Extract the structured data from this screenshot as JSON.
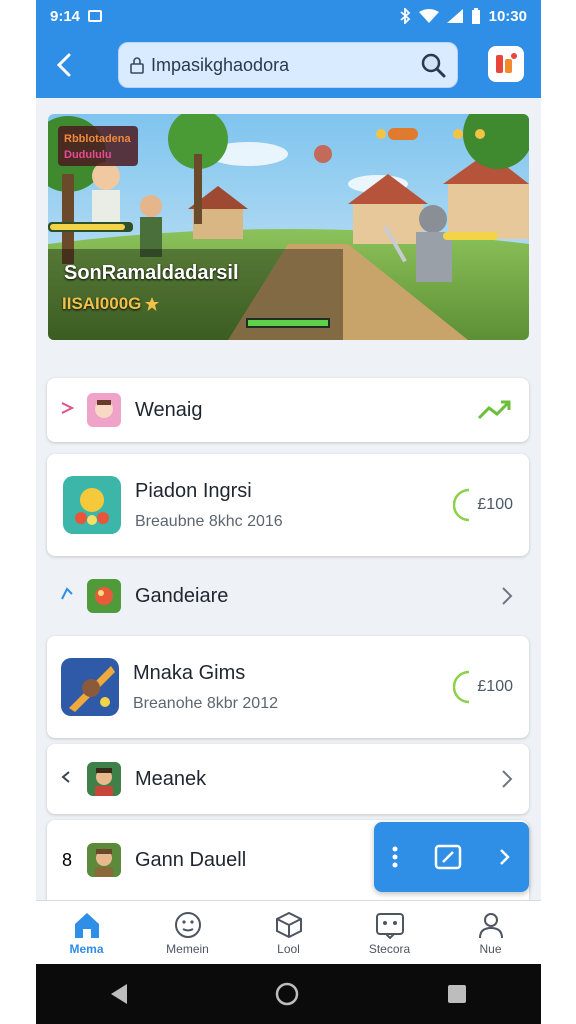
{
  "status_bar": {
    "time": "9:14",
    "right_time": "10:30"
  },
  "search": {
    "value": "Impasikghaodora"
  },
  "banner": {
    "logo_text": "Rbblotadena",
    "title": "SonRamaldadarsil",
    "subtitle": "IISAI000G"
  },
  "list": [
    {
      "title": "Wenaig"
    },
    {
      "title": "Piadon Ingrsi",
      "sub": "Breaubne 8khc 2016",
      "price": "£100"
    },
    {
      "title": "Gandeiare"
    },
    {
      "title": "Mnaka Gims",
      "sub": "Breanohe 8kbr 2012",
      "price": "£100"
    },
    {
      "title": "Meanek"
    },
    {
      "title": "Gann Dauell",
      "lead": "8"
    }
  ],
  "bottom_nav": [
    {
      "label": "Mema",
      "icon": "home-icon"
    },
    {
      "label": "Memein",
      "icon": "smile-icon"
    },
    {
      "label": "Lool",
      "icon": "box-icon"
    },
    {
      "label": "Stecora",
      "icon": "store-icon"
    },
    {
      "label": "Nue",
      "icon": "profile-icon"
    }
  ],
  "colors": {
    "primary": "#2f8ee6",
    "background": "#eef1f5"
  }
}
